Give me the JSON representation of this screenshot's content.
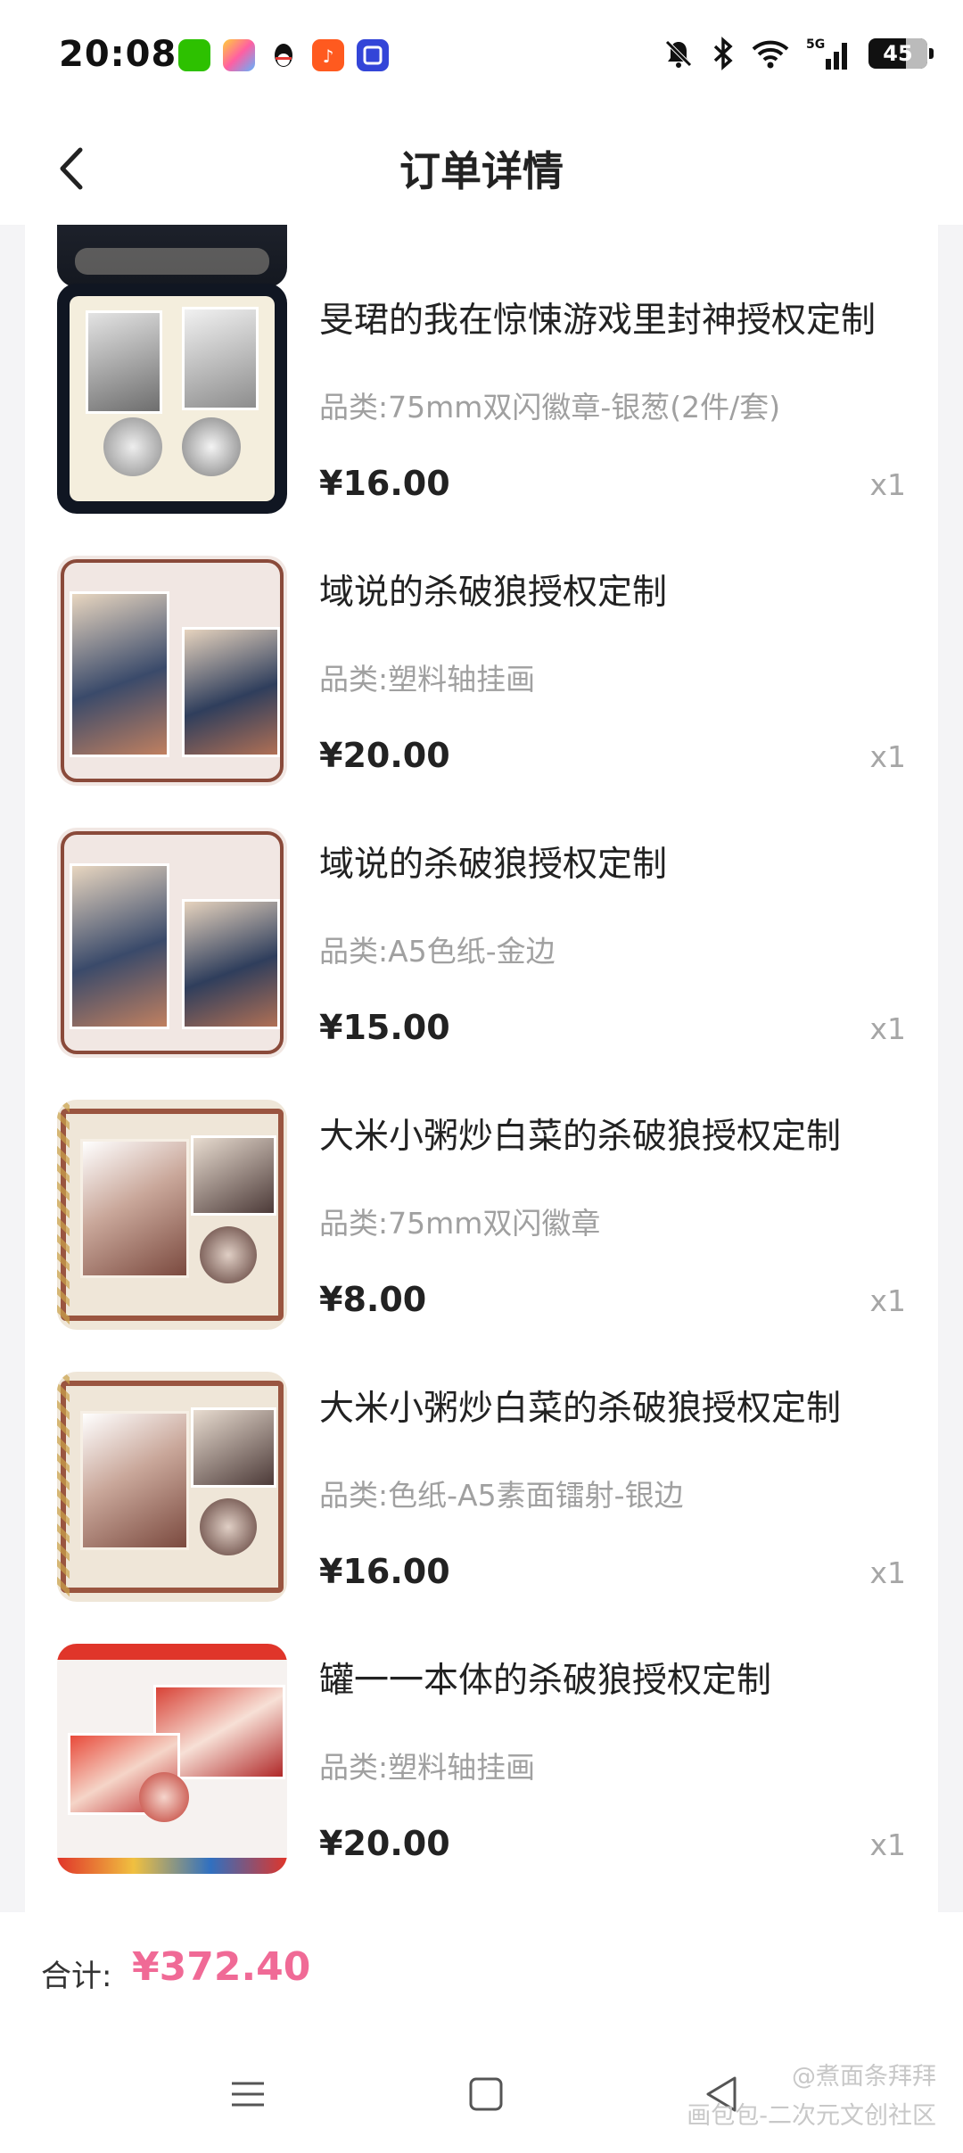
{
  "status_bar": {
    "time": "20:08",
    "app_icons": [
      "wechat-icon",
      "app-icon",
      "qq-icon",
      "listen-app-icon",
      "square-app-icon"
    ],
    "system_icons": [
      "mute-bell-icon",
      "bluetooth-icon",
      "wifi-icon",
      "5g-signal-icon",
      "battery-icon"
    ],
    "battery": "45"
  },
  "header": {
    "title": "订单详情"
  },
  "items": [
    {
      "title": "旻珺的我在惊悚游戏里封神授权定制",
      "spec": "品类:75mm双闪徽章-银葱(2件/套)",
      "price": "¥16.00",
      "qty": "x1"
    },
    {
      "title": "域说的杀破狼授权定制",
      "spec": "品类:塑料轴挂画",
      "price": "¥20.00",
      "qty": "x1"
    },
    {
      "title": "域说的杀破狼授权定制",
      "spec": "品类:A5色纸-金边",
      "price": "¥15.00",
      "qty": "x1"
    },
    {
      "title": "大米小粥炒白菜的杀破狼授权定制",
      "spec": "品类:75mm双闪徽章",
      "price": "¥8.00",
      "qty": "x1"
    },
    {
      "title": "大米小粥炒白菜的杀破狼授权定制",
      "spec": "品类:色纸-A5素面镭射-银边",
      "price": "¥16.00",
      "qty": "x1"
    },
    {
      "title": "罐一一本体的杀破狼授权定制",
      "spec": "品类:塑料轴挂画",
      "price": "¥20.00",
      "qty": "x1"
    }
  ],
  "footer": {
    "total_label": "合计:",
    "total_value": "¥372.40"
  },
  "watermark": {
    "line1": "@煮面条拜拜",
    "line2": "画包包-二次元文创社区"
  },
  "colors": {
    "accent_pink": "#f06a96",
    "background": "#f4f4f6"
  }
}
